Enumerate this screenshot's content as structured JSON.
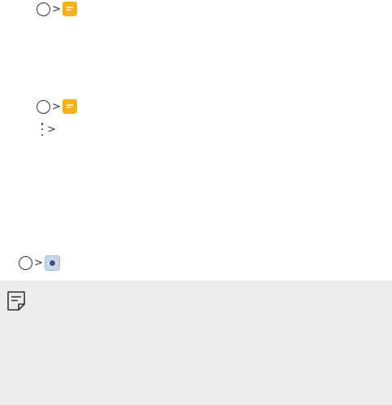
{
  "icons": {
    "home": "home-button-icon",
    "chevron": ">",
    "messaging": "messaging-app-icon",
    "more_options": "more-options-icon",
    "camera": "camera-app-icon",
    "note": "note-icon"
  },
  "colors": {
    "messaging_icon": "#f2b21b",
    "camera_icon_bg": "#c8d7e8",
    "camera_lens": "#3b4f8c",
    "note_background": "#ececec",
    "text": "#333333"
  }
}
